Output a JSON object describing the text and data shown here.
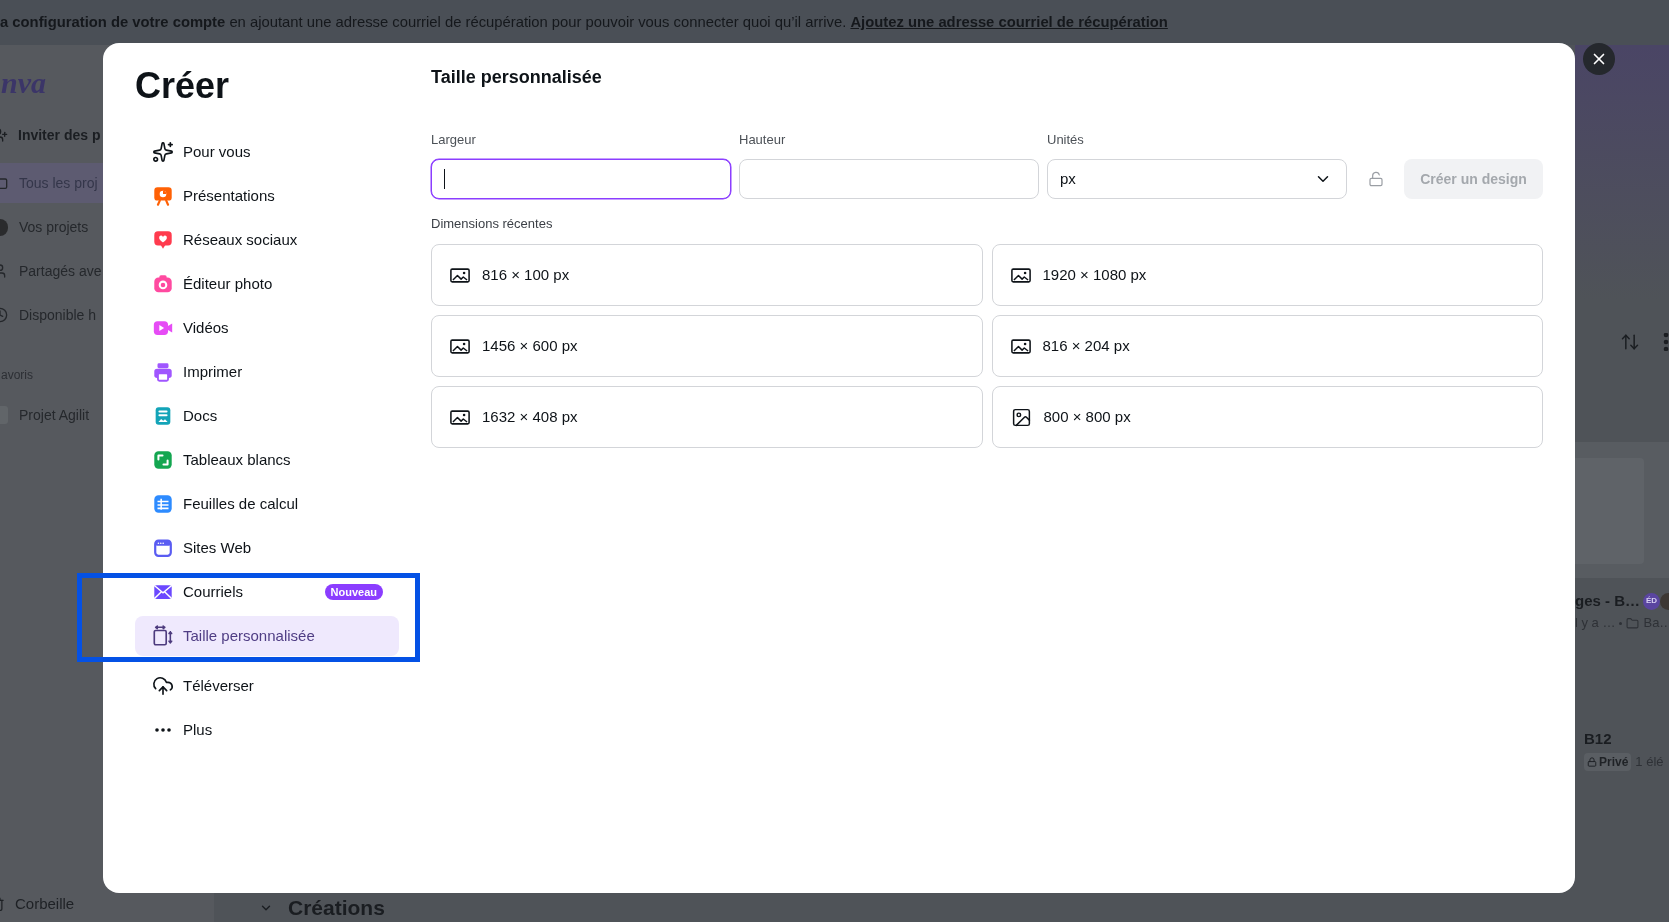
{
  "banner": {
    "text": "**a configuration de votre compte** en ajoutant une adresse courriel de récupération pour pouvoir vous connecter quoi qu’il arrive.",
    "link": "Ajoutez une adresse courriel de récupération"
  },
  "background": {
    "logo": "nva",
    "invite_button": "Inviter des p",
    "nav": [
      {
        "label": "Tous les proj",
        "selected": true
      },
      {
        "label": "Vos projets",
        "selected": false
      },
      {
        "label": "Partagés ave",
        "selected": false
      },
      {
        "label": "Disponible h",
        "selected": false
      }
    ],
    "favorites_title": "avoris",
    "favorites": [
      {
        "label": "Projet Agilit"
      }
    ],
    "trash": "Corbeille",
    "section_heading": "Créations",
    "design_card": {
      "title": "ges - B…",
      "avatar_initials": "ÉD",
      "time": "l y a …",
      "folder": "Ba…"
    },
    "folder_card": {
      "title": "B12",
      "visibility": "Privé",
      "count": "1 élé"
    }
  },
  "dialog": {
    "title": "Créer",
    "nav": [
      {
        "label": "Pour vous",
        "selected": false,
        "highlighted": false
      },
      {
        "label": "Présentations",
        "selected": false,
        "highlighted": false
      },
      {
        "label": "Réseaux sociaux",
        "selected": false,
        "highlighted": false
      },
      {
        "label": "Éditeur photo",
        "selected": false,
        "highlighted": false
      },
      {
        "label": "Vidéos",
        "selected": false,
        "highlighted": false
      },
      {
        "label": "Imprimer",
        "selected": false,
        "highlighted": false
      },
      {
        "label": "Docs",
        "selected": false,
        "highlighted": false
      },
      {
        "label": "Tableaux blancs",
        "selected": false,
        "highlighted": false
      },
      {
        "label": "Feuilles de calcul",
        "selected": false,
        "highlighted": false
      },
      {
        "label": "Sites Web",
        "selected": false,
        "highlighted": false
      },
      {
        "label": "Courriels",
        "badge": "Nouveau",
        "selected": false,
        "highlighted": true
      },
      {
        "label": "Taille personnalisée",
        "selected": true,
        "highlighted": true
      },
      {
        "label": "Téléverser",
        "selected": false,
        "highlighted": false
      },
      {
        "label": "Plus",
        "selected": false,
        "highlighted": false
      }
    ],
    "panel": {
      "title": "Taille personnalisée",
      "fields": [
        {
          "kind": "number",
          "label": "Largeur",
          "focused": true
        },
        {
          "kind": "number",
          "label": "Hauteur",
          "focused": false
        },
        {
          "kind": "select",
          "label": "Unités",
          "value": "px",
          "focused": false
        }
      ],
      "aspect_locked": false,
      "create_button": {
        "label": "Créer un design",
        "disabled": true
      },
      "recent_title": "Dimensions récentes",
      "recent": [
        {
          "kind": "landscape",
          "label": "816 × 100 px"
        },
        {
          "kind": "landscape",
          "label": "1920 × 1080 px"
        },
        {
          "kind": "landscape",
          "label": "1456 × 600 px"
        },
        {
          "kind": "landscape",
          "label": "816 × 204 px"
        },
        {
          "kind": "landscape",
          "label": "1632 × 408 px"
        },
        {
          "kind": "square",
          "label": "800 × 800 px"
        }
      ]
    }
  }
}
